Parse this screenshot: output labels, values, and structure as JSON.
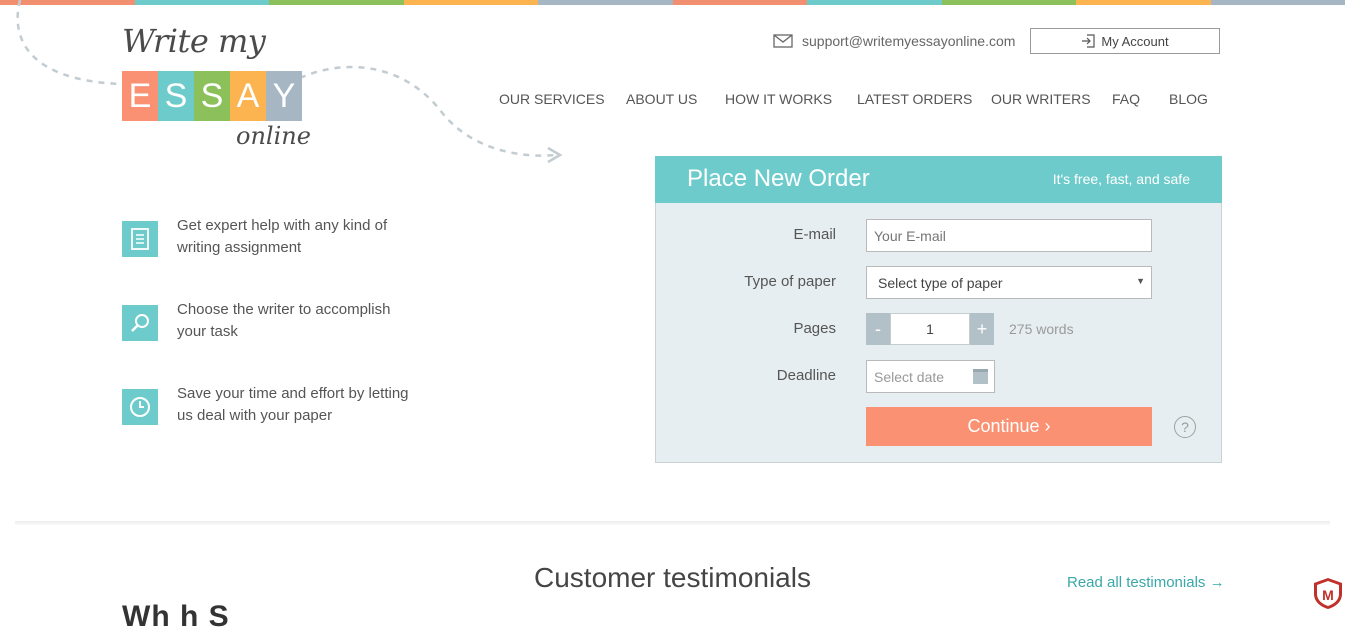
{
  "colors": {
    "teal": "#6ecbcb",
    "salmon": "#fa9173",
    "green": "#8bc05a",
    "orange": "#fbb450",
    "gray": "#a6b7c3",
    "topbar": [
      "#f28f71",
      "#6ecbcb",
      "#8bc05a",
      "#fbb450",
      "#a6b7c3",
      "#f28f71",
      "#6ecbcb",
      "#8bc05a",
      "#fbb450",
      "#a6b7c3"
    ]
  },
  "logo": {
    "top_text": "Write my",
    "letters": [
      "E",
      "S",
      "S",
      "A",
      "Y"
    ],
    "bottom_text": "online"
  },
  "header": {
    "support_email": "support@writemyessayonline.com",
    "account_label": "My Account",
    "icons": {
      "email": "envelope-icon",
      "account": "login-icon"
    }
  },
  "nav": {
    "items": [
      "OUR SERVICES",
      "ABOUT US",
      "HOW IT WORKS",
      "LATEST ORDERS",
      "OUR WRITERS",
      "FAQ",
      "BLOG"
    ]
  },
  "features": [
    {
      "icon": "document-icon",
      "text": "Get expert help with any kind of writing assignment"
    },
    {
      "icon": "magnifier-icon",
      "text": "Choose the writer to accomplish your task"
    },
    {
      "icon": "clock-icon",
      "text": "Save your time and effort by letting us deal with your paper"
    }
  ],
  "order_form": {
    "title": "Place New Order",
    "tagline": "It's free, fast, and safe",
    "email_label": "E-mail",
    "email_placeholder": "Your E-mail",
    "paper_label": "Type of paper",
    "paper_selected": "Select type of paper",
    "pages_label": "Pages",
    "pages_minus": "-",
    "pages_value": "1",
    "pages_plus": "+",
    "words": "275 words",
    "deadline_label": "Deadline",
    "deadline_placeholder": "Select date",
    "continue_label": "Continue ›",
    "help_label": "?"
  },
  "testimonials": {
    "title": "Customer testimonials",
    "read_all": "Read all testimonials →",
    "next_heading_partial": "Wh     h    S"
  }
}
